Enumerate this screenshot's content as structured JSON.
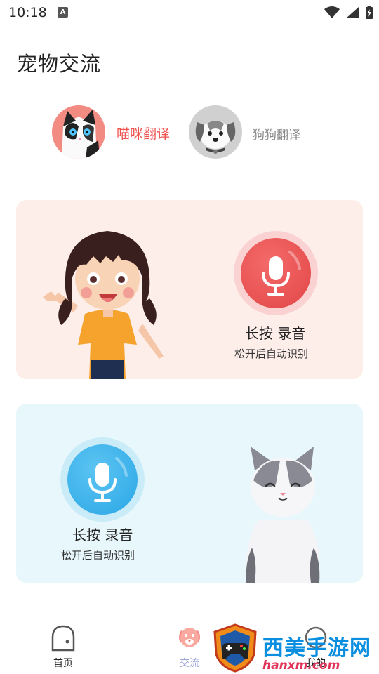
{
  "status_bar": {
    "time": "10:18",
    "notification_badge": "A"
  },
  "header": {
    "title": "宠物交流"
  },
  "pet_tabs": [
    {
      "label": "喵咪翻译",
      "icon": "cat-avatar-icon",
      "selected": true
    },
    {
      "label": "狗狗翻译",
      "icon": "dog-avatar-icon",
      "selected": false
    }
  ],
  "cards": {
    "human": {
      "title": "长按 录音",
      "subtitle": "松开后自动识别",
      "illustration": "girl-illustration"
    },
    "pet": {
      "title": "长按 录音",
      "subtitle": "松开后自动识别",
      "illustration": "cat-illustration"
    }
  },
  "bottom_nav": {
    "items": [
      {
        "label": "首页",
        "icon": "home-icon"
      },
      {
        "label": "交流",
        "icon": "dog-face-icon"
      },
      {
        "label": "我的",
        "icon": "profile-icon"
      }
    ]
  },
  "watermark": {
    "text": "西美手游网",
    "url": "hanxm.com"
  },
  "colors": {
    "accent_red": "#ef5350",
    "pink_card_bg": "#fdeee9",
    "blue_card_bg": "#e7f7fc",
    "active_nav": "#9fa8da"
  }
}
